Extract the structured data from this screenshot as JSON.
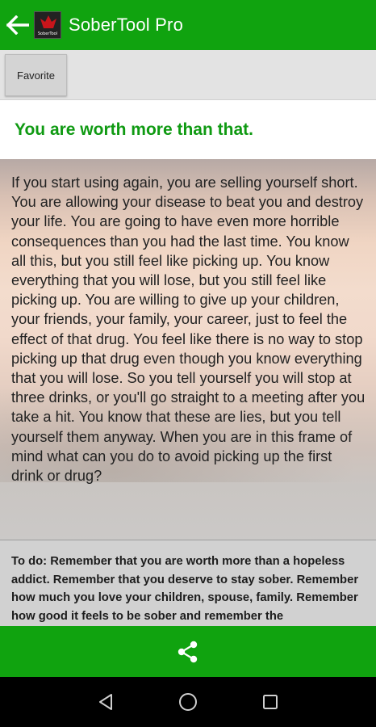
{
  "app": {
    "title": "SoberTool Pro",
    "logo_text": "SoberTool"
  },
  "toolbar": {
    "favorite_label": "Favorite"
  },
  "reading": {
    "heading": "You are worth more than that.",
    "body": "If you start using again, you are selling yourself short. You are allowing your disease to beat you and destroy your life. You are going to have even more horrible consequences than you had the last time. You know all this, but you still feel like picking up. You know everything that you will lose, but you still feel like picking up. You are willing to give up your children, your friends, your family, your career, just to feel the effect of that drug. You feel like there is no way to stop picking up that drug even though you know everything that you will lose. So you tell yourself you will stop at three drinks, or you'll go straight to a meeting after you take a hit. You know that these are lies, but you tell yourself them anyway. When you are in this frame of mind what can you do to avoid picking up the first drink or drug?",
    "todo": "To do: Remember that you are worth more than a hopeless addict. Remember that you deserve to stay sober. Remember how much you love your children, spouse, family. Remember how good it feels to be sober and remember the consequences of picking up."
  },
  "icons": {
    "back": "arrow-left-icon",
    "share": "share-icon",
    "nav_back": "triangle-back-icon",
    "nav_home": "circle-home-icon",
    "nav_recents": "square-recents-icon"
  },
  "colors": {
    "brand_green": "#10a30f",
    "heading_green": "#0f9a12"
  }
}
